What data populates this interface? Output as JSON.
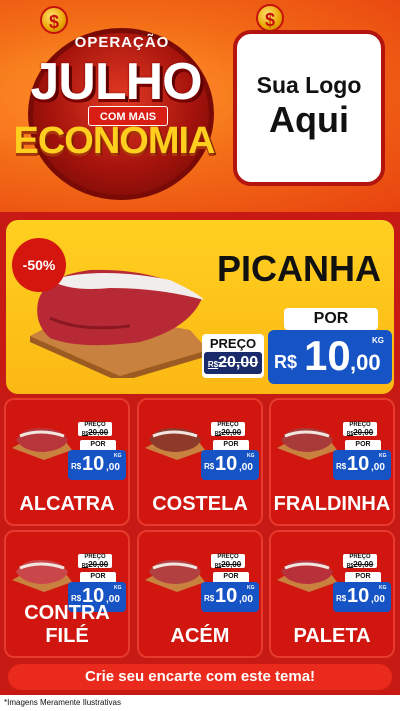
{
  "header": {
    "coin_symbol": "$",
    "badge_top": "OPERAÇÃO",
    "badge_main": "JULHO",
    "badge_mid": "COM MAIS",
    "badge_bottom": "ECONOMIA",
    "logo_line1": "Sua Logo",
    "logo_line2": "Aqui"
  },
  "featured": {
    "discount": "-50%",
    "name": "PICANHA",
    "preco_label": "PREÇO",
    "old_price_prefix": "R$",
    "old_price": "20,00",
    "por_label": "POR",
    "currency": "R$",
    "price_int": "10",
    "price_cents": ",00",
    "unit": "KG"
  },
  "price_common": {
    "preco_label": "PREÇO",
    "old_prefix": "R$",
    "old_price": "20,00",
    "por_label": "POR",
    "currency": "R$",
    "price_int": "10",
    "price_cents": ",00",
    "unit": "KG"
  },
  "products": [
    {
      "name": "ALCATRA"
    },
    {
      "name": "COSTELA"
    },
    {
      "name": "FRALDINHA"
    },
    {
      "name": "CONTRA FILÉ"
    },
    {
      "name": "ACÉM"
    },
    {
      "name": "PALETA"
    }
  ],
  "banner": "Crie seu encarte com este tema!",
  "footnote": "*Imagens Meramente Ilustrativas",
  "colors": {
    "header_orange": "#f36d17",
    "red": "#d0160f",
    "yellow": "#ffd020",
    "price_blue": "#1653c5"
  }
}
